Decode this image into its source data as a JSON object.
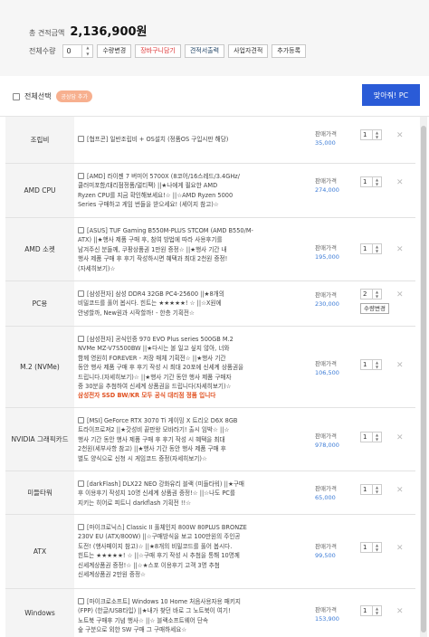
{
  "summary": {
    "total_label": "총 견적금액",
    "total_value": "2,136,900원",
    "qty_label": "전체수량",
    "qty_value": "0",
    "buttons": [
      "수량변경",
      "장바구니담기",
      "견적서출력",
      "사업자견적",
      "추가등록"
    ]
  },
  "select_bar": {
    "select_all_label": "전체선택",
    "pill_label": "공상담 추가",
    "pc_button": "맞아줘! PC"
  },
  "rows": [
    {
      "category": "조립비",
      "lines": [
        "[협프콘] 일반조립비 + OS설치 (정품OS 구입시만 해당)"
      ],
      "warning": "",
      "price_label": "판매가격",
      "price": "35,000",
      "qty": "1",
      "remove": "✕"
    },
    {
      "category": "AMD CPU",
      "lines": [
        "[AMD] 라이젠 7 버미어 5700X (8코어/16스레드/3.4GHz/",
        "쿨러미포함/대리점정품/멀티팩) ||★나에게 필요한 AMD",
        "Ryzen CPU를 지금 확인해보세요!☆ ||☆AMD Ryzen 5000",
        "Series 구매하고 게임 번들을 받으세요! (세이지 참고)☆"
      ],
      "warning": "",
      "price_label": "판매가격",
      "price": "274,000",
      "qty": "1",
      "remove": "✕"
    },
    {
      "category": "AMD 소켓",
      "lines": [
        "[ASUS] TUF Gaming B550M-PLUS STCOM (AMD B550/M-",
        "ATX) ||★행사 제품 구매 후, 참여 방법에 따라 사용후기를",
        "남겨주신 분들께, 쿠팡상품권 1만원 증정☆ ||★행사 기간 내",
        "행사 제품 구매 후 후기 작성하시면 혜택과 최대 2천원 증정!",
        "(자세히보기)☆"
      ],
      "warning": "",
      "price_label": "판매가격",
      "price": "195,000",
      "qty": "1",
      "remove": "✕"
    },
    {
      "category": "PC용",
      "lines": [
        "[삼성전자] 삼성 DDR4 32GB PC4-25600 ||★8개의",
        "비밀코드를 풀어 봅시다. 힌트는 ★★★★★! ☆ ||☆X원에",
        "안녕할까, New원과 시작할까! - 한층 기획전☆"
      ],
      "warning": "",
      "price_label": "판매가격",
      "price": "230,000",
      "qty": "2",
      "change_label": "수량변경",
      "remove": "✕"
    },
    {
      "category": "M.2 (NVMe)",
      "lines": [
        "[삼성전자] 공식인증 970 EVO Plus series 500GB M.2",
        "NVMe MZ-V7S500BW ||★다시는 볼 일고 싶지 않아, 너와",
        "함께 영원히 FOREVER - 저장 매체 기획전☆ ||★행사 기간",
        "동안 행사 제품 구매 후 후기 작성 시 최대 20포에 신세계 상품권을",
        "드립니다.(자세히보기)☆ ||★행사 기간 동안 행사 제품 구매자",
        "중 30분을 추첨하여 신세계 상품권을 드립니다(자세히보기)☆"
      ],
      "warning": "삼성전자 SSD BW/KR 모두 공식 대리점 정품 입니다",
      "price_label": "판매가격",
      "price": "106,500",
      "qty": "1",
      "remove": "✕"
    },
    {
      "category": "NVIDIA 그래픽카드",
      "lines": [
        "[MSI] GeForce RTX 3070 Ti 게이밍 X 트리오 D6X 8GB",
        "트라이프로져2 ||★갓성비 끝판왕 모바라기! 출시 임박☆ ||☆",
        "행사 기간 동안 행사 제품 구매 후 후기 작성 시 혜택을 최대",
        "2천원(세부사항 참고) ||★행사 기간 동안 행사 제품 구매 후",
        "별도 양식으로 신청 시 게임코드 증정(자세히보기)☆"
      ],
      "warning": "",
      "price_label": "판매가격",
      "price": "978,000",
      "qty": "1",
      "remove": "✕"
    },
    {
      "category": "미들타워",
      "lines": [
        "[darkFlash] DLX22 NEO 강화유리 블랙 (미들타워) ||★구매",
        "후 이용후기 작성지 10명 신세계 상품권 증정!☆ ||☆나도 PC를",
        "지키는 히어로 피트니 darkflash 기획전 !!☆"
      ],
      "warning": "",
      "price_label": "판매가격",
      "price": "65,000",
      "qty": "1",
      "remove": "✕"
    },
    {
      "category": "ATX",
      "lines": [
        "[마이크로닉스] Classic II 풀체인지 800W 80PLUS BRONZE",
        "230V EU (ATX/800W) ||☆구매방식을 보고 100만원의 주인공",
        "도전! (행사페이지 참고)☆ ||★8개의 비밀코드를 풀어 봅시다.",
        "힌트는 ★★★★★! ☆ ||☆구매 후기 작성 시 추첨을 통해 10명께",
        "신세계상품권 증정!☆ ||☆★스포 이용후기 고객 3명 추첨",
        "신세계상품권 2만원 증정☆"
      ],
      "warning": "",
      "price_label": "판매가격",
      "price": "99,500",
      "qty": "1",
      "remove": "✕"
    },
    {
      "category": "Windows",
      "lines": [
        "[마이크로소프트] Windows 10 Home 처음사용자용 패키지",
        "(FPP) (한글/USB타입) ||★내가 찾던 바로 그 노트북이 여기!",
        "노트북 구매후 기념 행사☆ ||☆ 블랙소프트웨어 단속",
        "숲 구분으로 외한 SW 구매 그 구매하세요☆"
      ],
      "warning": "",
      "price_label": "판매가격",
      "price": "153,900",
      "qty": "1",
      "remove": "✕"
    }
  ]
}
